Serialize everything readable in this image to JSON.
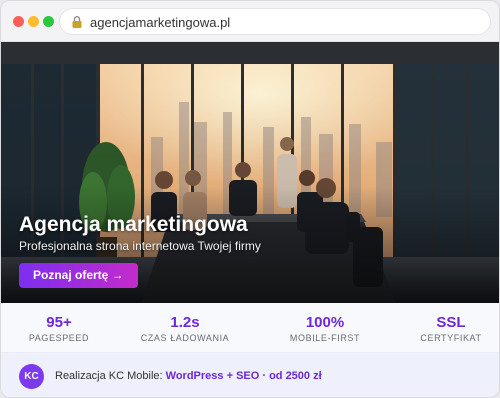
{
  "browser": {
    "url": "agencjamarketingowa.pl",
    "icons": {
      "lock": "lock-icon"
    }
  },
  "hero": {
    "title": "Agencja marketingowa",
    "subtitle": "Profesjonalna strona internetowa Twojej firmy",
    "cta_label": "Poznaj ofertę →"
  },
  "stats": [
    {
      "value": "95+",
      "label": "PAGESPEED"
    },
    {
      "value": "1.2s",
      "label": "CZAS ŁADOWANIA"
    },
    {
      "value": "100%",
      "label": "MOBILE-FIRST"
    },
    {
      "value": "SSL",
      "label": "CERTYFIKAT"
    }
  ],
  "footer": {
    "badge": "KC",
    "prefix": "Realizacja KC Mobile: ",
    "highlight": "WordPress + SEO · od 2500 zł"
  },
  "colors": {
    "accent": "#6d28d9",
    "cta_gradient_start": "#7d2ef0",
    "cta_gradient_end": "#c42bcb"
  }
}
